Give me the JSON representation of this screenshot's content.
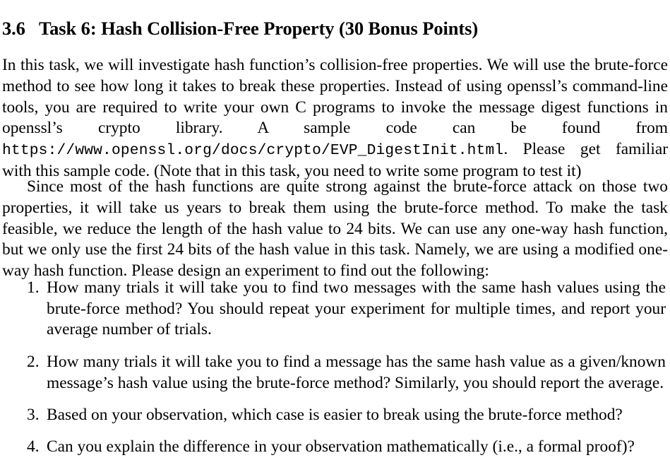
{
  "document": {
    "heading": {
      "number": "3.6",
      "title": "Task 6: Hash Collision-Free Property (30 Bonus Points)"
    },
    "paragraphs": [
      {
        "id": "intro",
        "runs": [
          {
            "type": "text",
            "value": "In this task, we will investigate hash function’s collision-free properties. We will use the brute-force method to see how long it takes to break these properties. Instead of using openssl’s command-line tools, you are required to write your own C programs to invoke the message digest functions in openssl’s crypto library. A sample code can be found from "
          },
          {
            "type": "mono",
            "value": "https://www.openssl.org/docs/crypto/EVP_DigestInit.html"
          },
          {
            "type": "text",
            "value": ". Please get familiar with this sample code. (Note that in this task, you need to write some program to test it)"
          }
        ]
      },
      {
        "id": "since",
        "runs": [
          {
            "type": "text",
            "value": "Since most of the hash functions are quite strong against the brute-force attack on those two properties, it will take us years to break them using the brute-force method. To make the task feasible, we reduce the length of the hash value to 24 bits. We can use any one-way hash function, but we only use the first 24 bits of the hash value in this task. Namely, we are using a modified one-way hash function. Please design an experiment to find out the following:"
          }
        ]
      }
    ],
    "list": {
      "items": [
        {
          "marker": "1.",
          "text": "How many trials it will take you to find two messages with the same hash values using the brute-force method? You should repeat your experiment for multiple times, and report your average number of trials."
        },
        {
          "marker": "2.",
          "text": "How many trials it will take you to find a message has the same hash value as a given/known message’s hash value using the brute-force method? Similarly, you should report the average."
        },
        {
          "marker": "3.",
          "text": "Based on your observation, which case is easier to break using the brute-force method?"
        },
        {
          "marker": "4.",
          "text": "Can you explain the difference in your observation mathematically (i.e., a formal proof)?"
        }
      ]
    },
    "colors": {
      "background": "#ffffff",
      "text": "#000000"
    }
  }
}
